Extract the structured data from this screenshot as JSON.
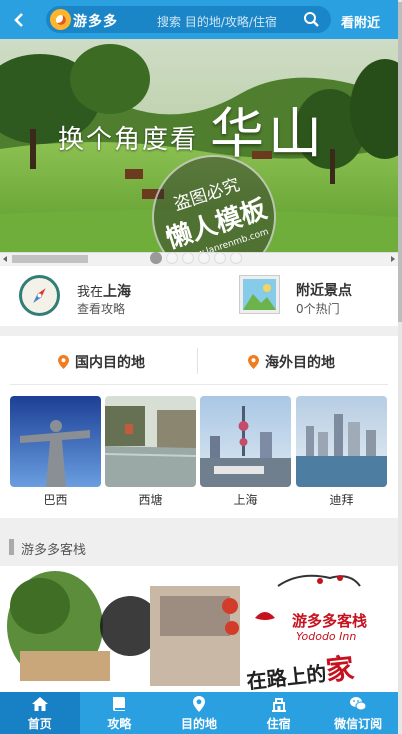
{
  "header": {
    "brand": "游多多",
    "search_placeholder": "搜索 目的地/攻略/住宿",
    "nearby_label": "看附近",
    "icons": [
      "back-arrow-icon",
      "logo-icon",
      "search-icon"
    ]
  },
  "banner": {
    "tagline": "换个角度看",
    "title": "华山",
    "stamp_line1": "盗图必究",
    "stamp_line2": "懒人模板",
    "stamp_line3": "www.lanrenmb.com",
    "slide_count": 6,
    "active_slide": 1
  },
  "quick": {
    "location_prefix": "我在",
    "location_city": "上海",
    "guide_label": "查看攻略",
    "nearby_title": "附近景点",
    "nearby_count": "0个热门"
  },
  "destinations": {
    "tabs": [
      {
        "label": "国内目的地"
      },
      {
        "label": "海外目的地"
      }
    ],
    "cities": [
      {
        "name": "巴西"
      },
      {
        "name": "西塘"
      },
      {
        "name": "上海"
      },
      {
        "name": "迪拜"
      }
    ]
  },
  "hostel_section": {
    "title": "游多多客栈",
    "brand_cn": "游多多客栈",
    "brand_en": "Yododo Inn",
    "slogan_a": "在路",
    "slogan_b": "上的",
    "slogan_c": "家"
  },
  "bottom_nav": [
    {
      "label": "首页",
      "icon": "home-icon",
      "active": true
    },
    {
      "label": "攻略",
      "icon": "book-icon",
      "active": false
    },
    {
      "label": "目的地",
      "icon": "location-pin-icon",
      "active": false
    },
    {
      "label": "住宿",
      "icon": "hotel-icon",
      "active": false
    },
    {
      "label": "微信订阅",
      "icon": "wechat-icon",
      "active": false
    }
  ],
  "colors": {
    "primary": "#2ba0e0",
    "primary_dark": "#1880c4",
    "pin_orange": "#f07c1e",
    "brand_red": "#c6121e"
  }
}
